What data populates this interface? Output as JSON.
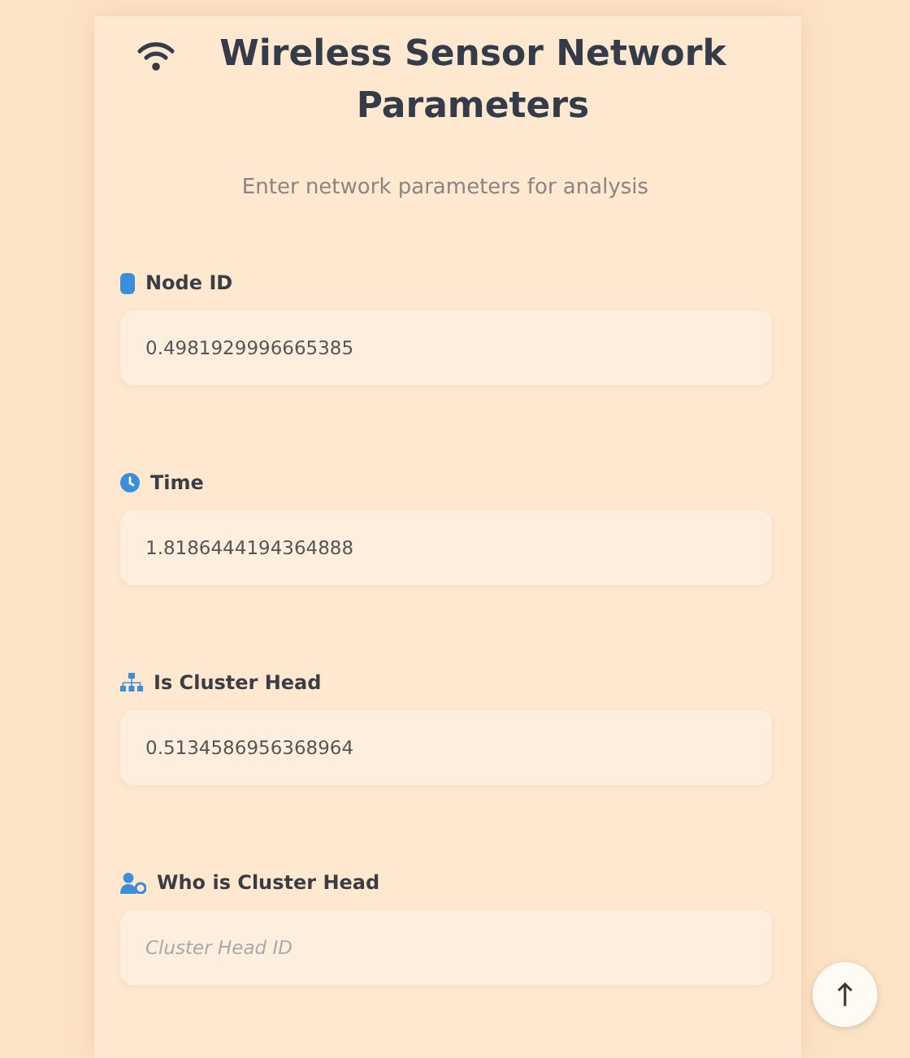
{
  "form": {
    "title": "Wireless Sensor Network Parameters",
    "subtitle": "Enter network parameters for analysis",
    "fields": [
      {
        "kind": "node",
        "label": "Node ID",
        "value": "0.4981929996665385"
      },
      {
        "kind": "time",
        "label": "Time",
        "value": "1.8186444194364888"
      },
      {
        "kind": "cluster",
        "label": "Is Cluster Head",
        "value": "0.5134586956368964"
      },
      {
        "kind": "person",
        "label": "Who is Cluster Head",
        "placeholder": "Cluster Head ID"
      }
    ]
  }
}
